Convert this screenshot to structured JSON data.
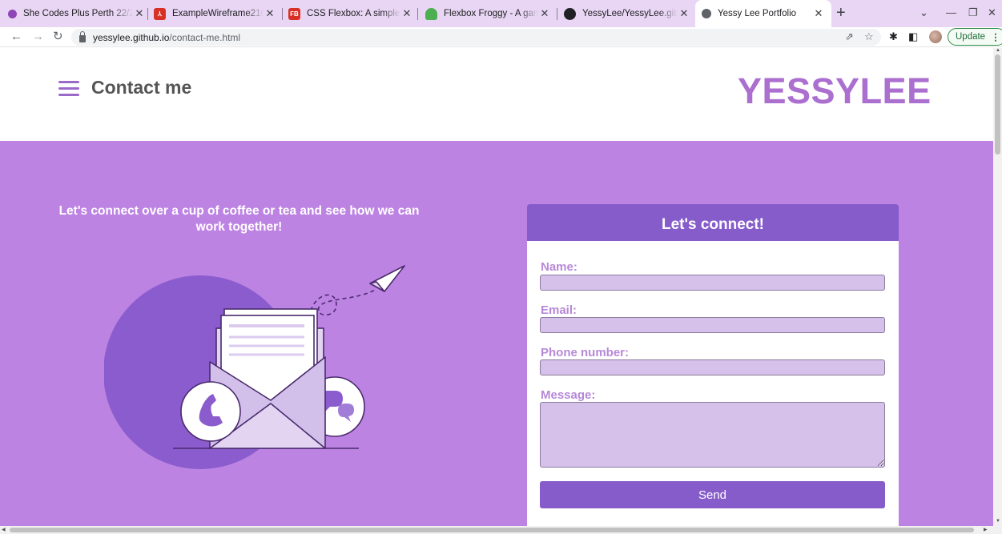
{
  "browser": {
    "tabs": [
      {
        "title": "She Codes Plus Perth 22/23",
        "icon": "she-codes-icon",
        "color": "#8e46b8"
      },
      {
        "title": "ExampleWireframe21042200",
        "icon": "pdf-icon",
        "color": "#d93025"
      },
      {
        "title": "CSS Flexbox: A simple visual",
        "icon": "fb-icon",
        "color": "#d93025"
      },
      {
        "title": "Flexbox Froggy - A game for",
        "icon": "frog-icon",
        "color": "#4caf50"
      },
      {
        "title": "YessyLee/YessyLee.github.io",
        "icon": "github-icon",
        "color": "#202124"
      },
      {
        "title": "Yessy Lee Portfolio",
        "icon": "globe-icon",
        "color": "#5f6368",
        "active": true
      }
    ],
    "url_host": "yessylee.github.io",
    "url_path": "/contact-me.html",
    "update_label": "Update"
  },
  "header": {
    "title": "Contact me",
    "brand": "YESSYLEE"
  },
  "hero": {
    "tagline": "Let's connect over a cup of coffee or tea and see how we can work together!"
  },
  "form": {
    "heading": "Let's connect!",
    "name_label": "Name:",
    "email_label": "Email:",
    "phone_label": "Phone number:",
    "message_label": "Message:",
    "send_label": "Send"
  },
  "colors": {
    "brand": "#ab6fd0",
    "hero_bg": "#bd83e3",
    "accent": "#865ccb",
    "input_bg": "#d5c1ea"
  }
}
